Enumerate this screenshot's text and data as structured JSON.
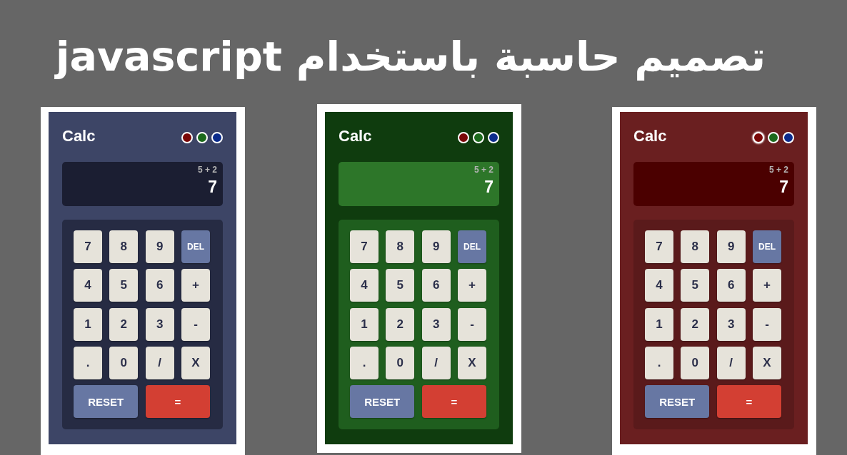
{
  "title": "تصميم حاسبة باستخدام javascript",
  "calculators": [
    {
      "color": "#3d4566",
      "app_title": "Calc",
      "dots": [
        {
          "color": "#7a0808",
          "selected": false
        },
        {
          "color": "#1c6a1c",
          "selected": false
        },
        {
          "color": "#0c2c8c",
          "selected": false
        }
      ],
      "display": {
        "color": "#1b1e32",
        "expression": "5 + 2",
        "result": "7"
      },
      "keypad": {
        "color": "#262b43",
        "keys": [
          {
            "label": "7",
            "kind": "digit"
          },
          {
            "label": "8",
            "kind": "digit"
          },
          {
            "label": "9",
            "kind": "digit"
          },
          {
            "label": "DEL",
            "kind": "delete"
          },
          {
            "label": "4",
            "kind": "digit"
          },
          {
            "label": "5",
            "kind": "digit"
          },
          {
            "label": "6",
            "kind": "digit"
          },
          {
            "label": "+",
            "kind": "operator"
          },
          {
            "label": "1",
            "kind": "digit"
          },
          {
            "label": "2",
            "kind": "digit"
          },
          {
            "label": "3",
            "kind": "digit"
          },
          {
            "label": "-",
            "kind": "operator"
          },
          {
            "label": ".",
            "kind": "digit"
          },
          {
            "label": "0",
            "kind": "digit"
          },
          {
            "label": "/",
            "kind": "operator"
          },
          {
            "label": "X",
            "kind": "operator"
          },
          {
            "label": "RESET",
            "kind": "reset"
          },
          {
            "label": "=",
            "kind": "equals"
          }
        ]
      }
    },
    {
      "color": "#0f3c0e",
      "app_title": "Calc",
      "dots": [
        {
          "color": "#7a0808",
          "selected": false
        },
        {
          "color": "#1c6a1c",
          "selected": false
        },
        {
          "color": "#0c2c8c",
          "selected": false
        }
      ],
      "display": {
        "color": "#2d7629",
        "expression": "5 + 2",
        "result": "7"
      },
      "keypad": {
        "color": "#1f5e1e",
        "keys": [
          {
            "label": "7",
            "kind": "digit"
          },
          {
            "label": "8",
            "kind": "digit"
          },
          {
            "label": "9",
            "kind": "digit"
          },
          {
            "label": "DEL",
            "kind": "delete"
          },
          {
            "label": "4",
            "kind": "digit"
          },
          {
            "label": "5",
            "kind": "digit"
          },
          {
            "label": "6",
            "kind": "digit"
          },
          {
            "label": "+",
            "kind": "operator"
          },
          {
            "label": "1",
            "kind": "digit"
          },
          {
            "label": "2",
            "kind": "digit"
          },
          {
            "label": "3",
            "kind": "digit"
          },
          {
            "label": "-",
            "kind": "operator"
          },
          {
            "label": ".",
            "kind": "digit"
          },
          {
            "label": "0",
            "kind": "digit"
          },
          {
            "label": "/",
            "kind": "operator"
          },
          {
            "label": "X",
            "kind": "operator"
          },
          {
            "label": "RESET",
            "kind": "reset"
          },
          {
            "label": "=",
            "kind": "equals"
          }
        ]
      }
    },
    {
      "color": "#6a1f20",
      "app_title": "Calc",
      "dots": [
        {
          "color": "#7a0808",
          "selected": true
        },
        {
          "color": "#1c6a1c",
          "selected": false
        },
        {
          "color": "#0c2c8c",
          "selected": false
        }
      ],
      "display": {
        "color": "#4b0000",
        "expression": "5 + 2",
        "result": "7"
      },
      "keypad": {
        "color": "#5a1a1b",
        "keys": [
          {
            "label": "7",
            "kind": "digit"
          },
          {
            "label": "8",
            "kind": "digit"
          },
          {
            "label": "9",
            "kind": "digit"
          },
          {
            "label": "DEL",
            "kind": "delete"
          },
          {
            "label": "4",
            "kind": "digit"
          },
          {
            "label": "5",
            "kind": "digit"
          },
          {
            "label": "6",
            "kind": "digit"
          },
          {
            "label": "+",
            "kind": "operator"
          },
          {
            "label": "1",
            "kind": "digit"
          },
          {
            "label": "2",
            "kind": "digit"
          },
          {
            "label": "3",
            "kind": "digit"
          },
          {
            "label": "-",
            "kind": "operator"
          },
          {
            "label": ".",
            "kind": "digit"
          },
          {
            "label": "0",
            "kind": "digit"
          },
          {
            "label": "/",
            "kind": "operator"
          },
          {
            "label": "X",
            "kind": "operator"
          },
          {
            "label": "RESET",
            "kind": "reset"
          },
          {
            "label": "=",
            "kind": "equals"
          }
        ]
      }
    }
  ]
}
